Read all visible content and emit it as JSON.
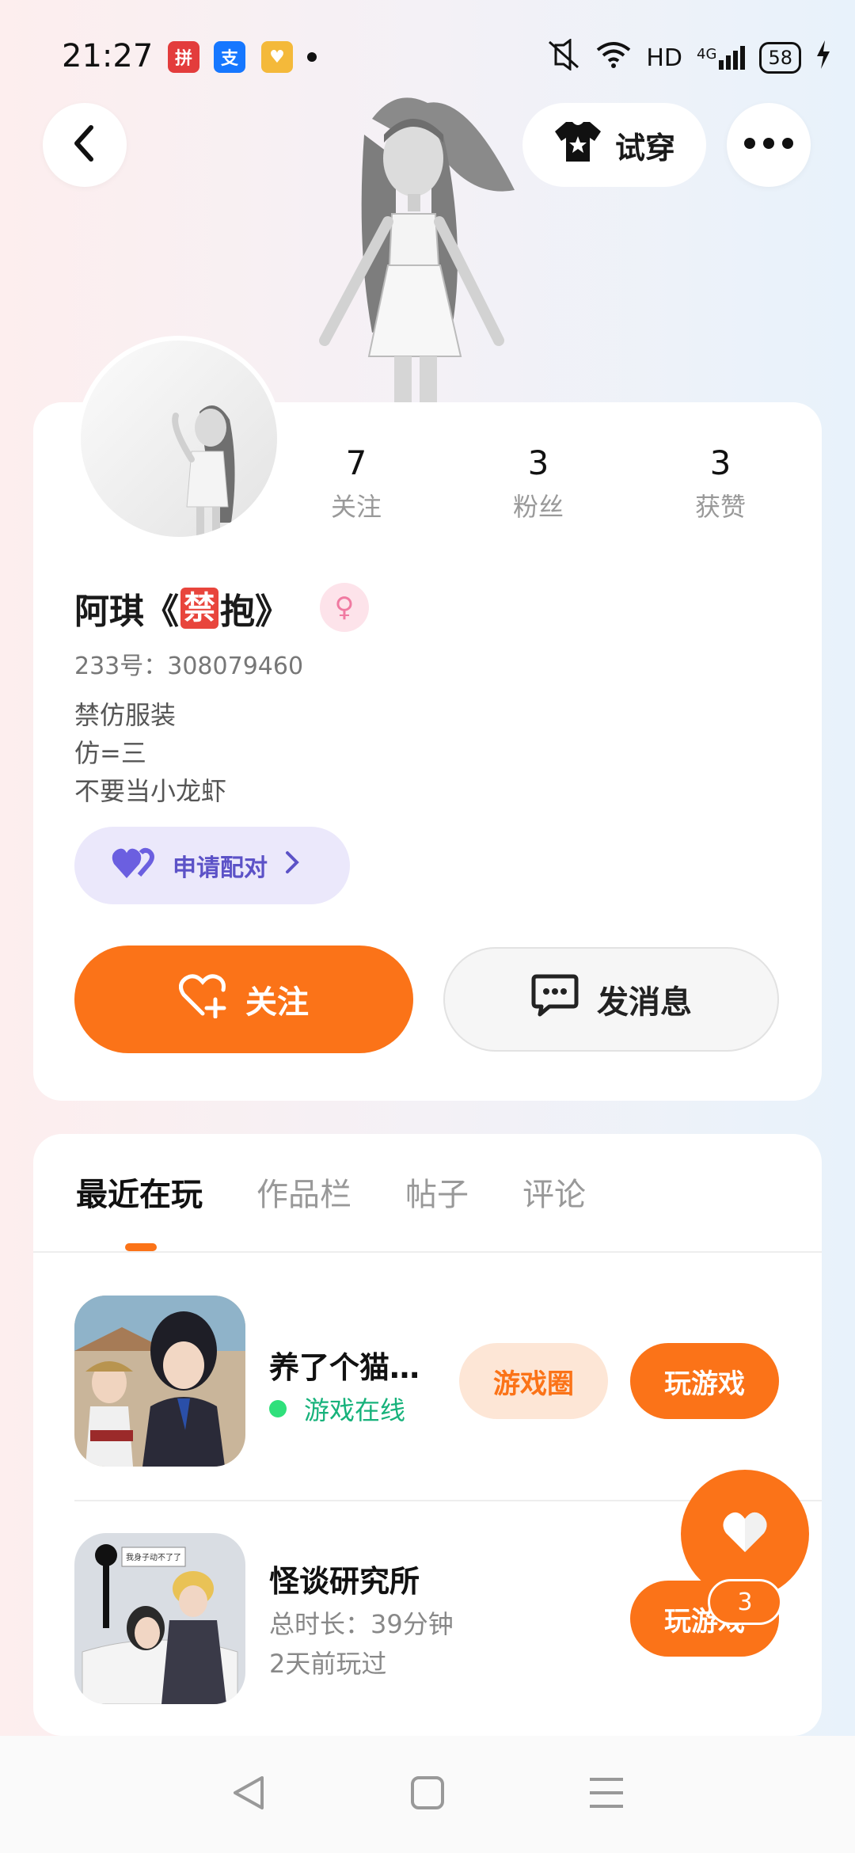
{
  "status_bar": {
    "time": "21:27",
    "network": "HD",
    "cell": "4G",
    "battery": "58",
    "apps": [
      {
        "icon": "pinduoduo-icon",
        "color": "#e33c3c"
      },
      {
        "icon": "alipay-icon",
        "color": "#1677ff"
      },
      {
        "icon": "vip-icon",
        "color": "#f4b93a"
      }
    ]
  },
  "header": {
    "try_on_label": "试穿"
  },
  "profile": {
    "stats": [
      {
        "num": "7",
        "label": "关注"
      },
      {
        "num": "3",
        "label": "粉丝"
      },
      {
        "num": "3",
        "label": "获赞"
      }
    ],
    "name_prefix": "阿琪《",
    "name_ban": "禁",
    "name_suffix": "抱》",
    "gender_symbol": "♀",
    "uid": "233号：308079460",
    "bio": [
      "禁仿服装",
      "仿=三",
      "不要当小龙虾"
    ],
    "pair_label": "申请配对",
    "follow_label": "关注",
    "message_label": "发消息"
  },
  "tabs": [
    "最近在玩",
    "作品栏",
    "帖子",
    "评论"
  ],
  "games": [
    {
      "title": "养了个猫…",
      "status": "游戏在线",
      "circle_label": "游戏圈",
      "play_label": "玩游戏"
    },
    {
      "title": "怪谈研究所",
      "duration": "总时长：39分钟",
      "last_played": "2天前玩过",
      "play_label": "玩游戏",
      "thumb_caption": "我身子动不了了"
    }
  ],
  "fab": {
    "count": "3"
  },
  "colors": {
    "accent": "#fb7318",
    "pair": "#5c52c7",
    "online": "#17b27b"
  }
}
